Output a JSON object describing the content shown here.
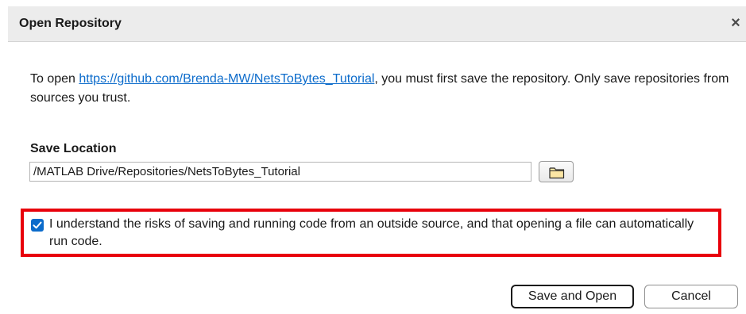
{
  "dialog": {
    "title": "Open Repository",
    "close_glyph": "×",
    "message_prefix": "To open ",
    "repo_url": "https://github.com/Brenda-MW/NetsToBytes_Tutorial",
    "message_suffix": ", you must first save the repository. Only save repositories from sources you trust.",
    "save_location_label": "Save Location",
    "save_location_value": "/MATLAB Drive/Repositories/NetsToBytes_Tutorial",
    "risk_ack_checked": true,
    "risk_ack_text": "I understand the risks of saving and running code from an outside source, and that opening a file can automatically run code.",
    "primary_button": "Save and Open",
    "cancel_button": "Cancel"
  },
  "icons": {
    "close": "close-icon",
    "folder": "folder-icon",
    "check": "checkmark-icon"
  },
  "colors": {
    "link": "#0b6bcb",
    "checkbox": "#0b6bcb",
    "highlight_border": "#e8000b",
    "titlebar": "#ececec",
    "folder_fill": "#fbe6a4"
  }
}
